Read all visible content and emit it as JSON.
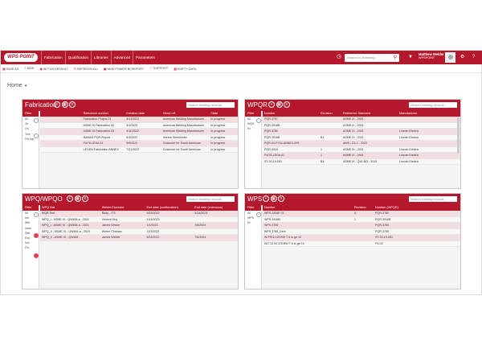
{
  "logo": "WPS POINT",
  "nav": [
    "Fabrication",
    "Qualification",
    "Libraries",
    "Advanced",
    "Parameters"
  ],
  "search": {
    "placeholder": "Search in 3Welding"
  },
  "user": {
    "name": "Matthew Welder",
    "role": "WPSPOINT"
  },
  "toolbar": [
    "SAVE AS",
    "NEW",
    "SET AS DEFAULT",
    "REFRESH ALL",
    "NEW POWER BI REPORT",
    "SUPPORT",
    "EMPTY DATA"
  ],
  "page_title": "Home",
  "panels": {
    "fabrication": {
      "title": "Fabrication",
      "search": "Search existing records",
      "filters": [
        "All",
        "4h",
        "On",
        "Tom",
        "Fin exp"
      ],
      "columns": [
        "Reference number",
        "Creation date",
        "Client ref.",
        "State"
      ],
      "rows": [
        [
          "Fabrication Project 01",
          "4/13/2022",
          "American Welding Manufacturer",
          "In progress"
        ],
        [
          "ASME IX Fabrication 02",
          "4/1/2022",
          "American Welding Manufacturer",
          "In progress"
        ],
        [
          "ASME IX Fabrication 03",
          "4/11/2022",
          "American Welding Manufacturer",
          "In progress"
        ],
        [
          "NAMAS PQR Report",
          "5/4/2022",
          "Interne Steelworks",
          "In progress"
        ],
        [
          "P4/78 LEGA 01",
          "5/9/2022",
          "Customer for South American",
          "In progress"
        ],
        [
          "LEGEN Fabrication ANNEX",
          "7/21/2022",
          "Customer for South American",
          "In progress"
        ]
      ]
    },
    "wpqr": {
      "title": "WPQR",
      "search": "Search existing records",
      "filters": [
        "All",
        "WQS",
        "En"
      ],
      "columns": [
        "Number",
        "Revision",
        "Reference Standard",
        "Manufacturer"
      ],
      "rows": [
        [
          "PQR-3757",
          "",
          "ASME IX - 2021",
          ""
        ],
        [
          "PQR-3916B",
          "",
          "ASME IX - 2021",
          ""
        ],
        [
          "PQR-3780",
          "",
          "ASME IX - 2021",
          "Lincoln Electric"
        ],
        [
          "PQR-3916B",
          "B1",
          "ASME IX - 2021",
          "Lincoln Electric"
        ],
        [
          "PQR-00-P734-ANNEX-005",
          "",
          "AWS - D1.1 : 2020",
          ""
        ],
        [
          "PQR-3915",
          "1",
          "ASME IX - 2021",
          "Lincoln Electric"
        ],
        [
          "P4/78-LEGA 01",
          "1",
          "ASME IX - 2021",
          "Lincoln Electric"
        ],
        [
          "ST-00-19-081",
          "B1",
          "ASME IX - QW-483 : 2010",
          "Lincoln Electric"
        ]
      ]
    },
    "wpq": {
      "title": "WPQ/WPQO",
      "search": "Search existing records",
      "filters": [
        "All",
        "Mo",
        "Wel",
        "mare",
        "Stat",
        "Exp",
        "Incr",
        "Fin"
      ],
      "columns": [
        "WPQ Nat.",
        "Welder/Operator",
        "End date (confirmation)",
        "End date (extension)"
      ],
      "rows": [
        [
          "WQB Test",
          "Rudy - IT5",
          "6/23/2022",
          "3/24/2023"
        ],
        [
          "WPQ_I - ASME IX - QW484-a - 2021",
          "Vincent Guy",
          "1/14/2023",
          ""
        ],
        [
          "WPQ_I - ASME IX - QW484-a - 2021",
          "James Welder",
          "1/1/2023",
          "7/6/2024"
        ],
        [
          "WPQ_II - ASME IX - QW484-a - 2019",
          "Weber Christan",
          "11/3/2022",
          ""
        ],
        [
          "WPQ_II - ASME IX - QW484",
          "James Welder",
          "6/16/2022",
          "7/6/2024"
        ]
      ]
    },
    "wps": {
      "title": "WPS",
      "search": "Search existing records",
      "filters": [
        "All",
        "WPS",
        "En"
      ],
      "columns": [
        "Number",
        "Revision",
        "Number (WPQR)"
      ],
      "rows": [
        [
          "WPS-ASME 01",
          "A",
          "PQR-3780"
        ],
        [
          "WPS-3916B",
          "1",
          "PQR-3916B"
        ],
        [
          "WPS-3780",
          "",
          "PQR-3780"
        ],
        [
          "WPS 3780_Dem",
          "",
          "PQR-3780"
        ],
        [
          "W-PROJ-05 BW T 6 to ge 10",
          "",
          "ST-00-19-081"
        ],
        [
          "WC 12 04 376 BW T 6 to ge 10",
          "",
          "P4-03"
        ]
      ]
    }
  }
}
